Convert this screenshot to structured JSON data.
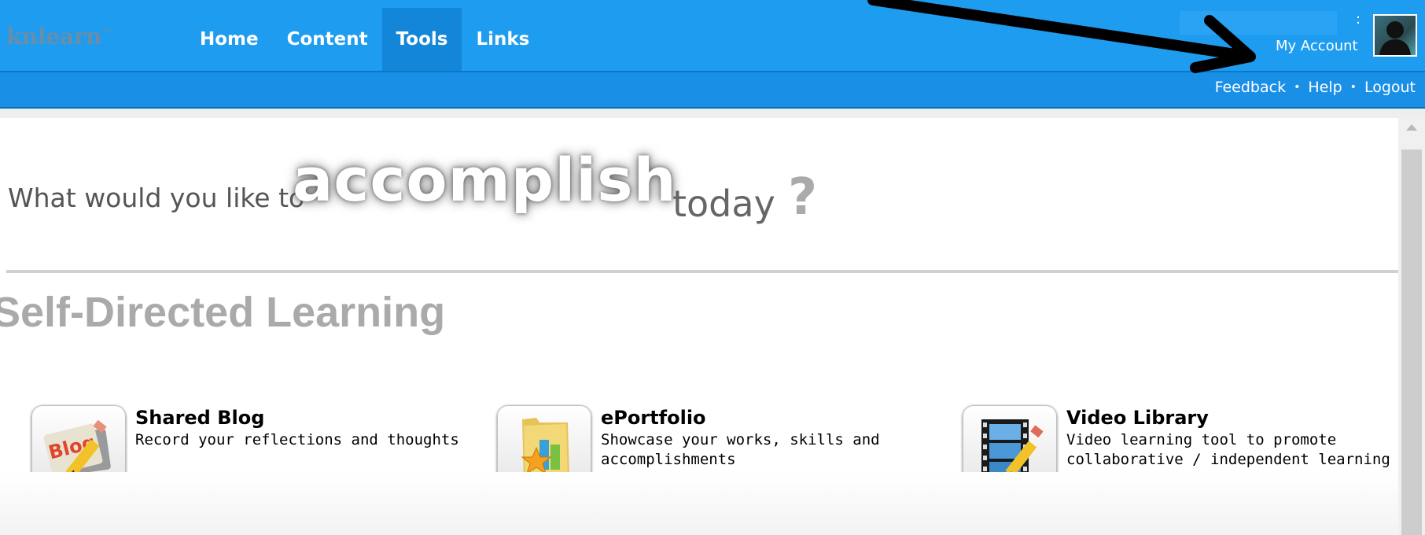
{
  "header": {
    "logo_text": "knlearn",
    "logo_mark": "™",
    "nav": [
      {
        "label": "Home"
      },
      {
        "label": "Content"
      },
      {
        "label": "Tools"
      },
      {
        "label": "Links"
      }
    ],
    "active_nav": "Tools",
    "account_dots": ":",
    "my_account": "My Account",
    "sub_links": [
      "Feedback",
      "Help",
      "Logout"
    ],
    "separator": "•",
    "accent_color": "#1e9cf0"
  },
  "hero": {
    "small": "What would you like to",
    "big": "accomplish",
    "today": "today",
    "question": "?"
  },
  "section": {
    "title": "Self-Directed Learning"
  },
  "tools": [
    {
      "title": "Shared Blog",
      "desc": "Record your reflections and thoughts",
      "icon": "blog-icon"
    },
    {
      "title": "ePortfolio",
      "desc": "Showcase your works, skills and accomplishments",
      "icon": "folder-star-icon"
    },
    {
      "title": "Video Library",
      "desc": "Video learning tool to promote collaborative / independent learning",
      "icon": "film-pencil-icon"
    }
  ],
  "annotation": {
    "arrow_color": "#000000"
  }
}
